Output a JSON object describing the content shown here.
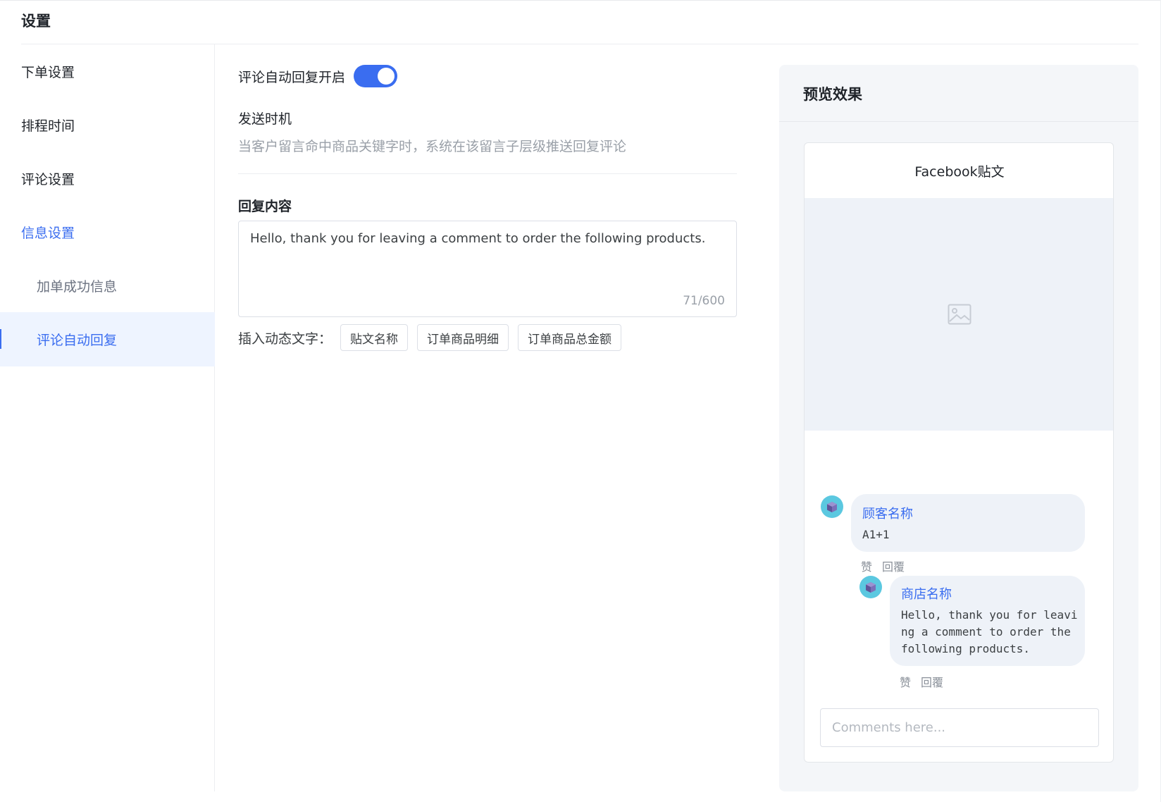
{
  "page": {
    "title": "设置"
  },
  "sidebar": {
    "items": [
      {
        "label": "下单设置"
      },
      {
        "label": "排程时间"
      },
      {
        "label": "评论设置"
      },
      {
        "label": "信息设置"
      },
      {
        "label": "加单成功信息"
      },
      {
        "label": "评论自动回复"
      }
    ]
  },
  "settings": {
    "toggle_label": "评论自动回复开启",
    "toggle_on": true,
    "send_timing_label": "发送时机",
    "send_timing_desc": "当客户留言命中商品关键字时，系统在该留言子层级推送回复评论",
    "reply_title": "回复内容",
    "reply_value": "Hello, thank you for leaving a comment to order the following products.",
    "reply_count": "71/600",
    "insert_label": "插入动态文字：",
    "tags": [
      "贴文名称",
      "订单商品明细",
      "订单商品总金额"
    ]
  },
  "preview": {
    "title": "预览效果",
    "post_title": "Facebook贴文",
    "customer": {
      "name": "顾客名称",
      "message": "A1+1"
    },
    "shop": {
      "name": "商店名称",
      "message_lines": [
        "Hello, thank you for leavi",
        "ng a comment to order the",
        "following products."
      ]
    },
    "actions": {
      "like": "赞",
      "reply": "回覆"
    },
    "comment_placeholder": "Comments here..."
  },
  "colors": {
    "accent": "#3a6df0",
    "active_bg": "#eef4ff",
    "avatar": "#5bc8e0"
  }
}
